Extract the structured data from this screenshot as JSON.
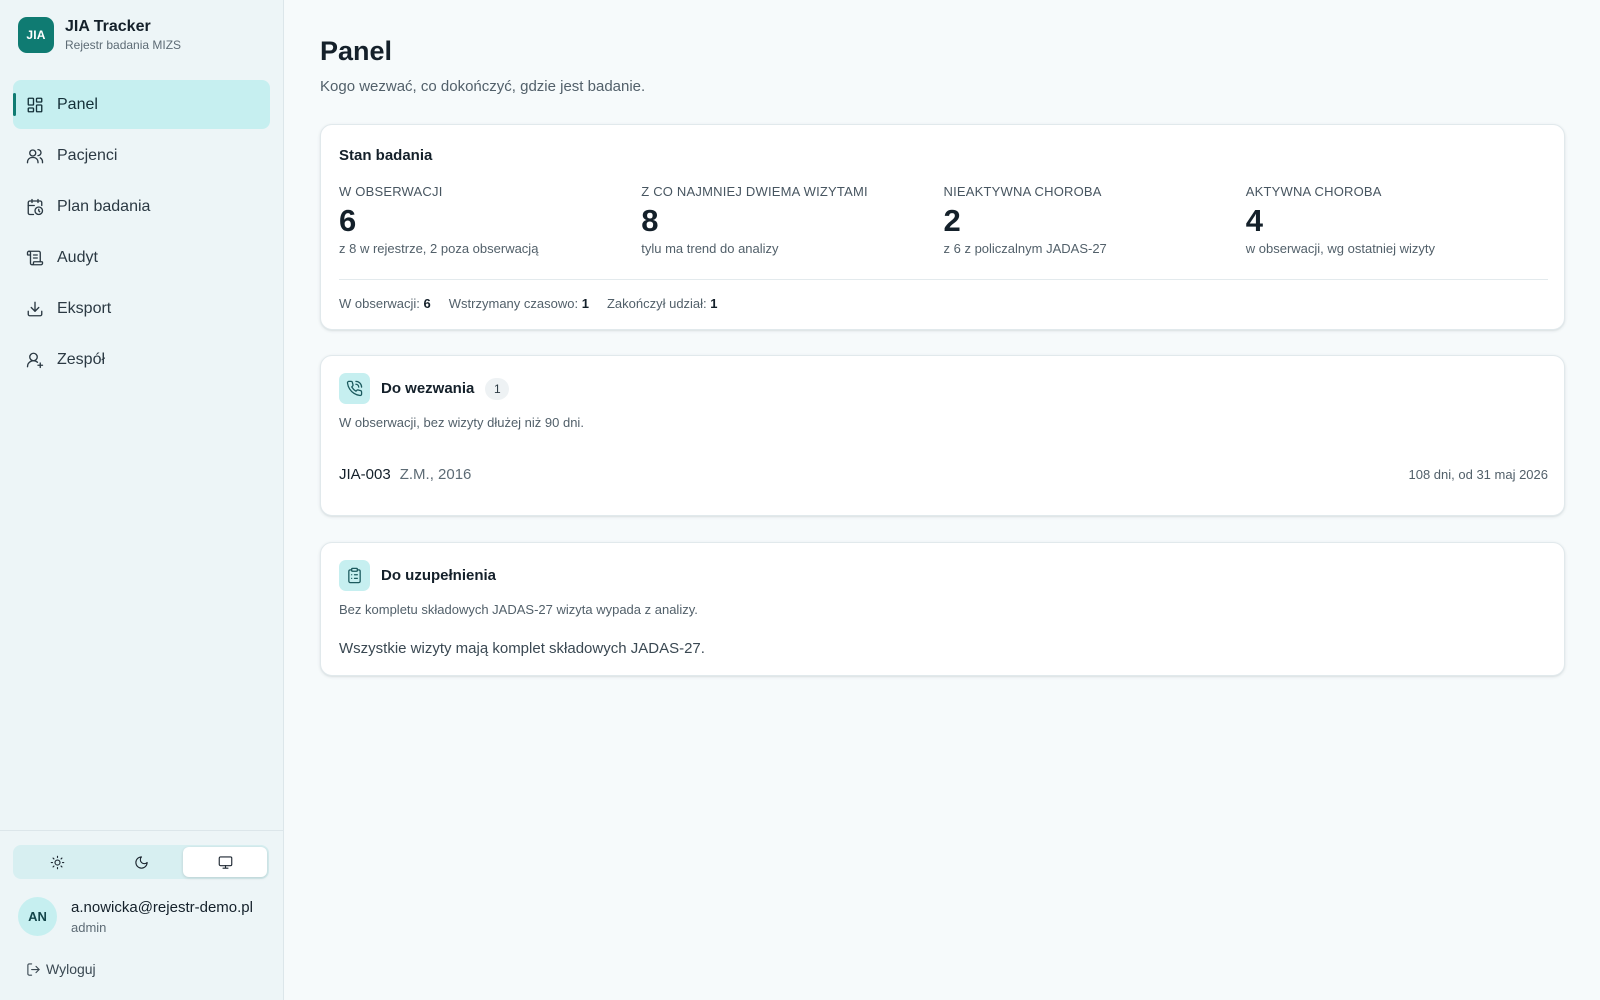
{
  "app": {
    "logo_text": "JIA",
    "title": "JIA Tracker",
    "subtitle": "Rejestr badania MIZS"
  },
  "nav": [
    {
      "label": "Panel",
      "icon": "dashboard-icon",
      "active": true
    },
    {
      "label": "Pacjenci",
      "icon": "users-icon"
    },
    {
      "label": "Plan badania",
      "icon": "calendar-clock-icon"
    },
    {
      "label": "Audyt",
      "icon": "scroll-icon"
    },
    {
      "label": "Eksport",
      "icon": "download-icon"
    },
    {
      "label": "Zespół",
      "icon": "user-icon"
    }
  ],
  "theme": {
    "options": [
      "sun-icon",
      "moon-icon",
      "monitor-icon"
    ],
    "selected": "monitor-icon"
  },
  "user": {
    "initials": "AN",
    "email": "a.nowicka@rejestr-demo.pl",
    "role": "admin",
    "logout_label": "Wyloguj"
  },
  "page": {
    "title": "Panel",
    "subtitle": "Kogo wezwać, co dokończyć, gdzie jest badanie."
  },
  "status_card": {
    "title": "Stan badania",
    "stats": [
      {
        "label": "W OBSERWACJI",
        "value": "6",
        "note": "z 8 w rejestrze, 2 poza obserwacją"
      },
      {
        "label": "Z CO NAJMNIEJ DWIEMA WIZYTAMI",
        "value": "8",
        "note": "tylu ma trend do analizy"
      },
      {
        "label": "NIEAKTYWNA CHOROBA",
        "value": "2",
        "note": "z 6 z policzalnym JADAS-27"
      },
      {
        "label": "AKTYWNA CHOROBA",
        "value": "4",
        "note": "w obserwacji, wg ostatniej wizyty"
      }
    ],
    "statuses": [
      {
        "label": "W obserwacji:",
        "value": "6"
      },
      {
        "label": "Wstrzymany czasowo:",
        "value": "1"
      },
      {
        "label": "Zakończył udział:",
        "value": "1"
      }
    ]
  },
  "call_card": {
    "title": "Do wezwania",
    "count": "1",
    "description": "W obserwacji, bez wizyty dłużej niż 90 dni.",
    "patients": [
      {
        "id": "JIA-003",
        "info": "Z.M., 2016",
        "days": "108 dni, od 31 maj 2026"
      }
    ]
  },
  "complete_card": {
    "title": "Do uzupełnienia",
    "description": "Bez kompletu składowych JADAS-27 wizyta wypada z analizy.",
    "message": "Wszystkie wizyty mają komplet składowych JADAS-27."
  }
}
